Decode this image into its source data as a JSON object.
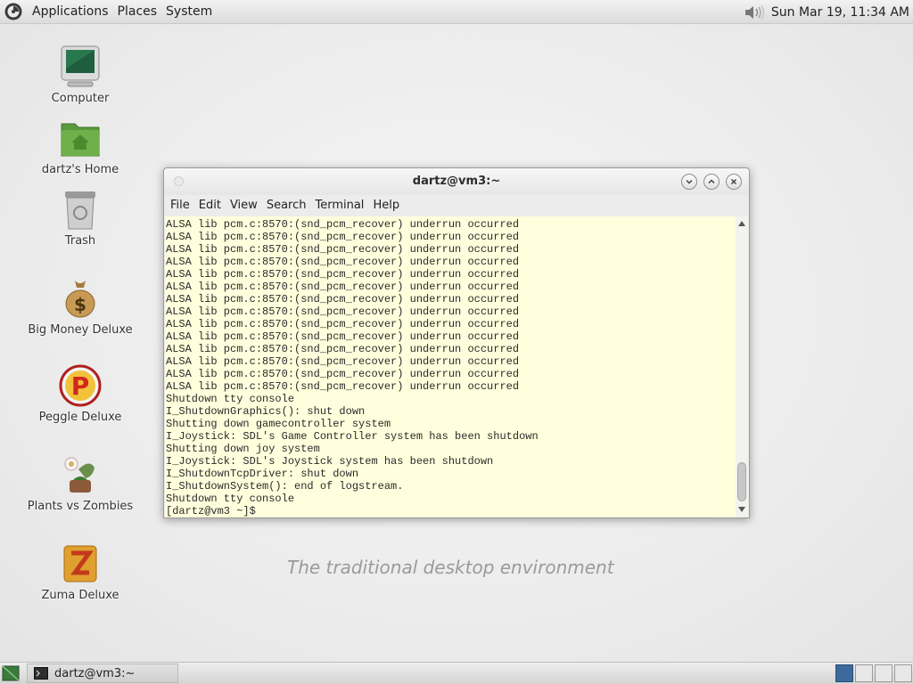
{
  "top_panel": {
    "menus": [
      "Applications",
      "Places",
      "System"
    ],
    "clock": "Sun Mar 19, 11:34 AM",
    "icons": [
      "distro-logo-icon",
      "volume-icon"
    ]
  },
  "desktop": {
    "icons": [
      {
        "label": "Computer",
        "icon": "computer-icon"
      },
      {
        "label": "dartz's Home",
        "icon": "home-folder-icon"
      },
      {
        "label": "Trash",
        "icon": "trash-icon"
      },
      {
        "label": "Big Money Deluxe",
        "icon": "money-bag-icon"
      },
      {
        "label": "Peggle Deluxe",
        "icon": "peggle-icon"
      },
      {
        "label": "Plants vs Zombies",
        "icon": "plants-vs-zombies-icon"
      },
      {
        "label": "Zuma Deluxe",
        "icon": "zuma-icon"
      }
    ],
    "tagline": "The traditional desktop environment"
  },
  "terminal": {
    "title": "dartz@vm3:~",
    "menus": [
      "File",
      "Edit",
      "View",
      "Search",
      "Terminal",
      "Help"
    ],
    "lines": [
      "ALSA lib pcm.c:8570:(snd_pcm_recover) underrun occurred",
      "ALSA lib pcm.c:8570:(snd_pcm_recover) underrun occurred",
      "ALSA lib pcm.c:8570:(snd_pcm_recover) underrun occurred",
      "ALSA lib pcm.c:8570:(snd_pcm_recover) underrun occurred",
      "ALSA lib pcm.c:8570:(snd_pcm_recover) underrun occurred",
      "ALSA lib pcm.c:8570:(snd_pcm_recover) underrun occurred",
      "ALSA lib pcm.c:8570:(snd_pcm_recover) underrun occurred",
      "ALSA lib pcm.c:8570:(snd_pcm_recover) underrun occurred",
      "ALSA lib pcm.c:8570:(snd_pcm_recover) underrun occurred",
      "ALSA lib pcm.c:8570:(snd_pcm_recover) underrun occurred",
      "ALSA lib pcm.c:8570:(snd_pcm_recover) underrun occurred",
      "ALSA lib pcm.c:8570:(snd_pcm_recover) underrun occurred",
      "ALSA lib pcm.c:8570:(snd_pcm_recover) underrun occurred",
      "ALSA lib pcm.c:8570:(snd_pcm_recover) underrun occurred",
      "Shutdown tty console",
      "I_ShutdownGraphics(): shut down",
      "Shutting down gamecontroller system",
      "I_Joystick: SDL's Game Controller system has been shutdown",
      "Shutting down joy system",
      "I_Joystick: SDL's Joystick system has been shutdown",
      "I_ShutdownTcpDriver: shut down",
      "I_ShutdownSystem(): end of logstream.",
      "Shutdown tty console",
      "[dartz@vm3 ~]$ "
    ],
    "colors": {
      "background": "#ffffdd",
      "text": "#2a2a2a"
    }
  },
  "bottom_panel": {
    "task_label": "dartz@vm3:~",
    "workspace_count": 4,
    "active_workspace": 1
  }
}
